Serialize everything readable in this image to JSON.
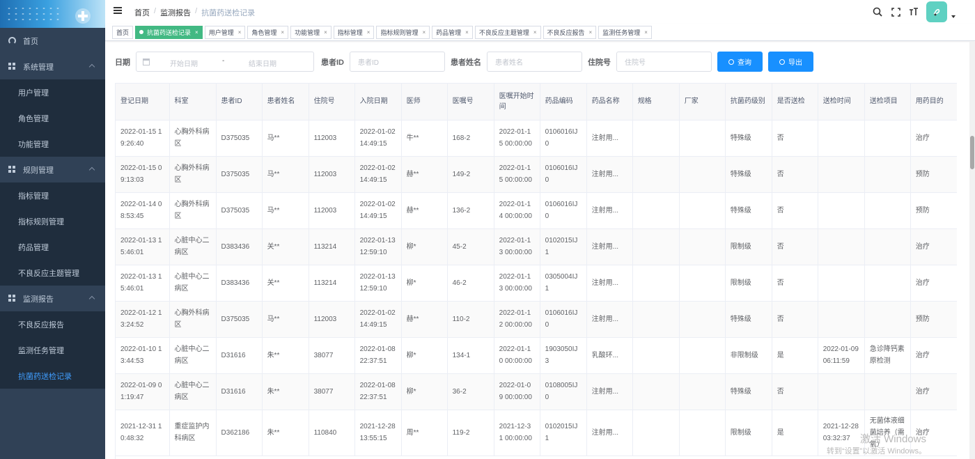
{
  "sidebar": {
    "items": [
      {
        "label": "首页",
        "type": "top",
        "icon": "dashboard-icon"
      },
      {
        "label": "系统管理",
        "type": "top",
        "icon": "grid-icon",
        "expanded": true
      },
      {
        "label": "用户管理",
        "type": "sub"
      },
      {
        "label": "角色管理",
        "type": "sub"
      },
      {
        "label": "功能管理",
        "type": "sub"
      },
      {
        "label": "规则管理",
        "type": "top",
        "icon": "grid-icon",
        "expanded": true
      },
      {
        "label": "指标管理",
        "type": "sub"
      },
      {
        "label": "指标规则管理",
        "type": "sub"
      },
      {
        "label": "药品管理",
        "type": "sub"
      },
      {
        "label": "不良反应主题管理",
        "type": "sub"
      },
      {
        "label": "监测报告",
        "type": "top",
        "icon": "grid-icon",
        "expanded": true
      },
      {
        "label": "不良反应报告",
        "type": "sub"
      },
      {
        "label": "监测任务管理",
        "type": "sub"
      },
      {
        "label": "抗菌药送检记录",
        "type": "sub",
        "active": true
      }
    ]
  },
  "breadcrumb": [
    "首页",
    "监测报告",
    "抗菌药送检记录"
  ],
  "tags": [
    {
      "label": "首页",
      "closable": false
    },
    {
      "label": "抗菌药送检记录",
      "closable": true,
      "active": true
    },
    {
      "label": "用户管理",
      "closable": true
    },
    {
      "label": "角色管理",
      "closable": true
    },
    {
      "label": "功能管理",
      "closable": true
    },
    {
      "label": "指标管理",
      "closable": true
    },
    {
      "label": "指标规则管理",
      "closable": true
    },
    {
      "label": "药品管理",
      "closable": true
    },
    {
      "label": "不良反应主题管理",
      "closable": true
    },
    {
      "label": "不良反应报告",
      "closable": true
    },
    {
      "label": "监测任务管理",
      "closable": true
    }
  ],
  "search": {
    "date_label": "日期",
    "date_start_placeholder": "开始日期",
    "date_sep": "-",
    "date_end_placeholder": "结束日期",
    "patient_id_label": "患者ID",
    "patient_id_placeholder": "患者ID",
    "patient_name_label": "患者姓名",
    "patient_name_placeholder": "患者姓名",
    "inpatient_no_label": "住院号",
    "inpatient_no_placeholder": "住院号",
    "query_button": "查询",
    "export_button": "导出"
  },
  "colors": {
    "accent": "#1890ff",
    "active_tag": "#42b983",
    "sidebar": "#304156",
    "sidebar_sub": "#1f2d3d",
    "active_menu_text": "#409eff"
  },
  "table": {
    "columns": [
      "登记日期",
      "科室",
      "患者ID",
      "患者姓名",
      "住院号",
      "入院日期",
      "医师",
      "医嘱号",
      "医嘱开始时间",
      "药品编码",
      "药品名称",
      "规格",
      "厂家",
      "抗菌药级别",
      "是否送检",
      "送检时间",
      "送检项目",
      "用药目的"
    ],
    "rows": [
      [
        "2022-01-15 19:26:40",
        "心胸外科病区",
        "D375035",
        "马**",
        "112003",
        "2022-01-02 14:49:15",
        "牛**",
        "168-2",
        "2022-01-15 00:00:00",
        "0106016IJ0",
        "注射用...",
        "",
        "",
        "特殊级",
        "否",
        "",
        "",
        "治疗"
      ],
      [
        "2022-01-15 09:13:03",
        "心胸外科病区",
        "D375035",
        "马**",
        "112003",
        "2022-01-02 14:49:15",
        "赫**",
        "149-2",
        "2022-01-15 00:00:00",
        "0106016IJ0",
        "注射用...",
        "",
        "",
        "特殊级",
        "否",
        "",
        "",
        "预防"
      ],
      [
        "2022-01-14 08:53:45",
        "心胸外科病区",
        "D375035",
        "马**",
        "112003",
        "2022-01-02 14:49:15",
        "赫**",
        "136-2",
        "2022-01-14 00:00:00",
        "0106016IJ0",
        "注射用...",
        "",
        "",
        "特殊级",
        "否",
        "",
        "",
        "预防"
      ],
      [
        "2022-01-13 15:46:01",
        "心脏中心二病区",
        "D383436",
        "关**",
        "113214",
        "2022-01-13 12:59:10",
        "柳*",
        "45-2",
        "2022-01-13 00:00:00",
        "0102015IJ1",
        "注射用...",
        "",
        "",
        "限制级",
        "否",
        "",
        "",
        "治疗"
      ],
      [
        "2022-01-13 15:46:01",
        "心脏中心二病区",
        "D383436",
        "关**",
        "113214",
        "2022-01-13 12:59:10",
        "柳*",
        "46-2",
        "2022-01-13 00:00:00",
        "0305004IJ1",
        "注射用...",
        "",
        "",
        "限制级",
        "否",
        "",
        "",
        "治疗"
      ],
      [
        "2022-01-12 13:24:52",
        "心胸外科病区",
        "D375035",
        "马**",
        "112003",
        "2022-01-02 14:49:15",
        "赫**",
        "110-2",
        "2022-01-12 00:00:00",
        "0106016IJ0",
        "注射用...",
        "",
        "",
        "特殊级",
        "否",
        "",
        "",
        "预防"
      ],
      [
        "2022-01-10 13:44:53",
        "心脏中心二病区",
        "D31616",
        "朱**",
        "38077",
        "2022-01-08 22:37:51",
        "柳*",
        "134-1",
        "2022-01-10 00:00:00",
        "1903050IJ3",
        "乳酸环...",
        "",
        "",
        "非限制级",
        "是",
        "2022-01-09 06:11:59",
        "急诊降钙素原检测",
        "治疗"
      ],
      [
        "2022-01-09 01:19:47",
        "心脏中心二病区",
        "D31616",
        "朱**",
        "38077",
        "2022-01-08 22:37:51",
        "柳*",
        "36-2",
        "2022-01-09 00:00:00",
        "0108005IJ0",
        "注射用...",
        "",
        "",
        "特殊级",
        "否",
        "",
        "",
        "治疗"
      ],
      [
        "2021-12-31 10:48:32",
        "重症监护内科病区",
        "D362186",
        "朱**",
        "110840",
        "2021-12-28 13:55:15",
        "周**",
        "119-2",
        "2021-12-31 00:00:00",
        "0102015IJ1",
        "注射用...",
        "",
        "",
        "限制级",
        "是",
        "2021-12-28 03:32:37",
        "无菌体液细菌培养（需氧）",
        "治疗"
      ]
    ]
  },
  "watermark": {
    "line1": "激活 Windows",
    "line2": "转到“设置”以激活 Windows。"
  }
}
